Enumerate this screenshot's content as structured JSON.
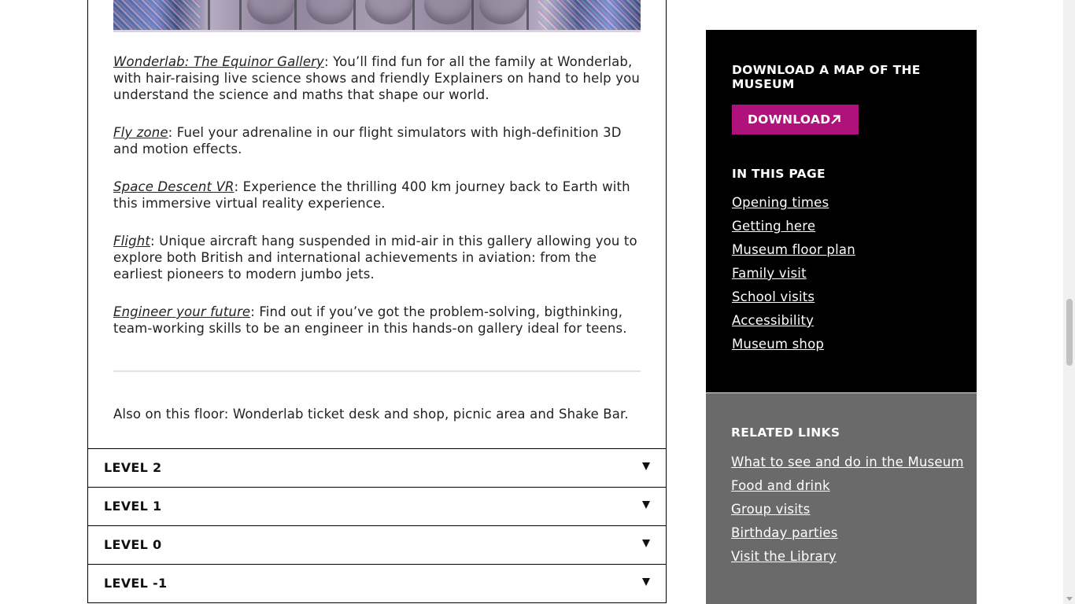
{
  "main": {
    "paragraphs": [
      {
        "link": "Wonderlab: The Equinor Gallery",
        "text": ": You’ll find fun for all the family at Wonderlab, with hair-raising live science shows and friendly Explainers on hand to help you understand the science and maths that shape our world."
      },
      {
        "link": "Fly zone",
        "text": ": Fuel your adrenaline in our flight simulators with high-definition 3D and motion effects."
      },
      {
        "link": "Space Descent VR",
        "text": ": Experience the thrilling 400 km journey back to Earth with this immersive virtual reality experience."
      },
      {
        "link": "Flight",
        "text": ": Unique aircraft hang suspended in mid-air in this gallery allowing you to explore both British and international achievements in aviation: from the earliest pioneers to modern jumbo jets."
      },
      {
        "link": "Engineer your future",
        "text": ": Find out if you’ve got the problem-solving, bigthinking, team-working skills to be an engineer in this hands-on gallery ideal for teens."
      }
    ],
    "also_on_floor": "Also on this floor: Wonderlab ticket desk and shop, picnic area and Shake Bar.",
    "levels": [
      "LEVEL 2",
      "LEVEL 1",
      "LEVEL 0",
      "LEVEL -1"
    ]
  },
  "sidebar": {
    "map_title": "DOWNLOAD A MAP OF THE MUSEUM",
    "download_label": "DOWNLOAD",
    "in_this_page_title": "IN THIS PAGE",
    "in_this_page": [
      "Opening times",
      "Getting here",
      "Museum floor plan",
      "Family visit",
      "School visits",
      "Accessibility",
      "Museum shop"
    ],
    "related_title": "RELATED LINKS",
    "related_links": [
      "What to see and do in the Museum",
      "Food and drink",
      "Group visits",
      "Birthday parties",
      "Visit the Library"
    ]
  },
  "colors": {
    "download_button": "#b0127c",
    "sidebar_dark": "#000000",
    "sidebar_grey": "#6a6a6a"
  },
  "icons": {
    "download_arrow": "arrow-up-right-icon",
    "level_toggle": "caret-down-icon"
  }
}
